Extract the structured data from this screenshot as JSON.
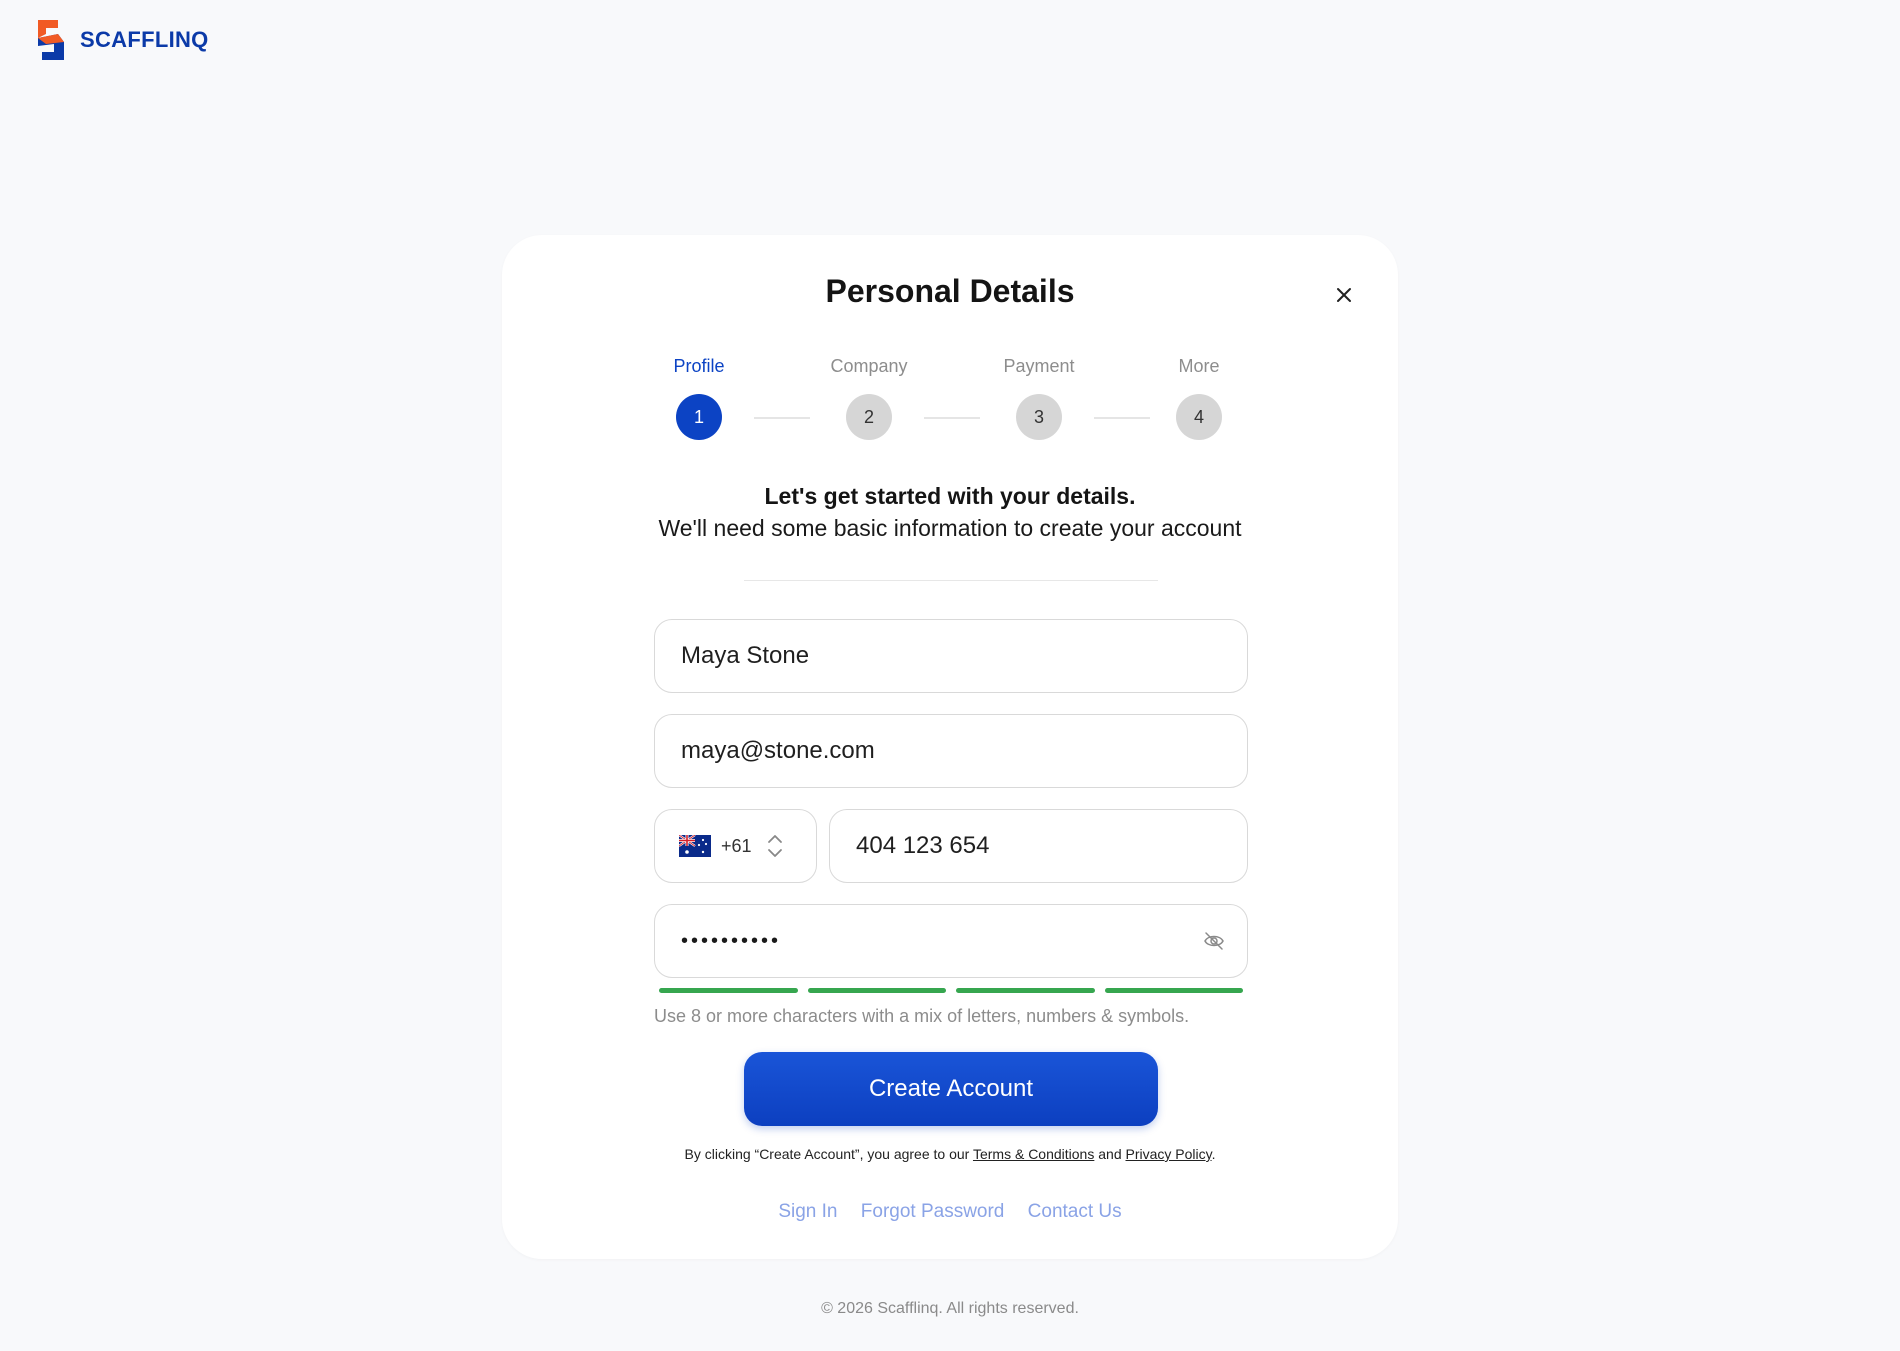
{
  "brand": {
    "name": "SCAFFLINQ",
    "primary": "#0c43c4",
    "accent": "#f15a24"
  },
  "modal": {
    "title": "Personal Details",
    "close_icon": "close-icon"
  },
  "steps": [
    {
      "label": "Profile",
      "number": "1",
      "active": true
    },
    {
      "label": "Company",
      "number": "2",
      "active": false
    },
    {
      "label": "Payment",
      "number": "3",
      "active": false
    },
    {
      "label": "More",
      "number": "4",
      "active": false
    }
  ],
  "intro": {
    "heading": "Let's get started with your details.",
    "subheading": "We'll need some basic information to create your account"
  },
  "form": {
    "name_value": "Maya Stone",
    "email_value": "maya@stone.com",
    "country_code": "+61",
    "country_flag": "australia-flag-icon",
    "phone_value": "404 123 654",
    "password_mask": "••••••••••",
    "password_strength_filled": 4,
    "password_strength_total": 4,
    "password_hint": "Use 8 or more characters with a mix of letters, numbers & symbols."
  },
  "actions": {
    "create_account": "Create Account"
  },
  "legal": {
    "prefix": "By clicking “Create Account”, you agree to our ",
    "terms": "Terms & Conditions",
    "middle": " and ",
    "privacy": "Privacy Policy",
    "suffix": "."
  },
  "links": {
    "sign_in": "Sign In",
    "forgot_password": "Forgot Password",
    "contact_us": "Contact Us"
  },
  "footer": {
    "copyright": "© 2026 Scafflinq. All rights reserved."
  },
  "colors": {
    "strength_bar": "#36a64f",
    "link": "#8aa3e6",
    "inactive_step": "#d6d6d6"
  }
}
